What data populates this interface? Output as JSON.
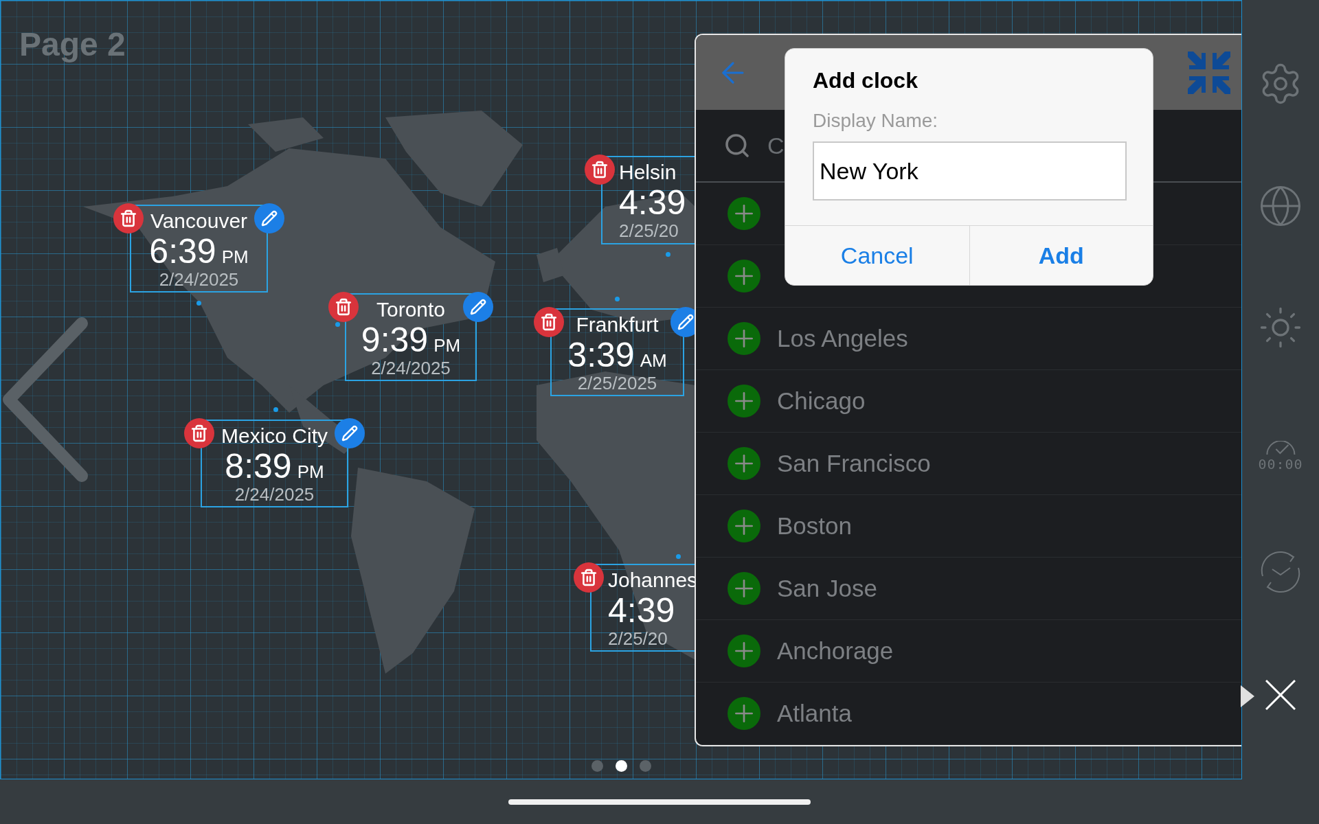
{
  "page_label": "Page 2",
  "clocks": [
    {
      "city": "Helsin",
      "time": "4:39",
      "date": "2/25/20",
      "edit_button": false
    },
    {
      "city": "Vancouver",
      "time": "6:39",
      "ampm": "PM",
      "date": "2/24/2025",
      "edit_button": true
    },
    {
      "city": "Toronto",
      "time": "9:39",
      "ampm": "PM",
      "date": "2/24/2025",
      "edit_button": true
    },
    {
      "city": "Frankfurt",
      "time": "3:39",
      "ampm": "AM",
      "date": "2/25/2025",
      "edit_button": true
    },
    {
      "city": "Mexico City",
      "time": "8:39",
      "ampm": "PM",
      "date": "2/24/2025",
      "edit_button": true
    },
    {
      "city": "Johannes",
      "time": "4:39",
      "date": "2/25/20",
      "edit_button": false
    }
  ],
  "pages": [
    {
      "selected": false
    },
    {
      "selected": true
    },
    {
      "selected": false
    }
  ],
  "panel": {
    "search": {
      "placeholder": "C"
    },
    "cities": [
      {
        "kind": "covered"
      },
      {
        "kind": "covered"
      },
      {
        "kind": "city",
        "name": "Los Angeles"
      },
      {
        "kind": "city",
        "name": "Chicago"
      },
      {
        "kind": "city",
        "name": "San Francisco"
      },
      {
        "kind": "city",
        "name": "Boston"
      },
      {
        "kind": "city",
        "name": "San Jose"
      },
      {
        "kind": "city",
        "name": "Anchorage"
      },
      {
        "kind": "city",
        "name": "Atlanta"
      }
    ],
    "dialog": {
      "title": "Add clock",
      "label": "Display Name:",
      "value": "New York",
      "buttons": [
        {
          "label": "Cancel",
          "primary": false
        },
        {
          "label": "Add",
          "primary": true
        }
      ]
    }
  },
  "sidebar": [
    {
      "kind": "settings"
    },
    {
      "kind": "globe"
    },
    {
      "kind": "brightness"
    },
    {
      "kind": "timer",
      "label": "00:00"
    },
    {
      "kind": "sync"
    },
    {
      "kind": "close"
    }
  ]
}
